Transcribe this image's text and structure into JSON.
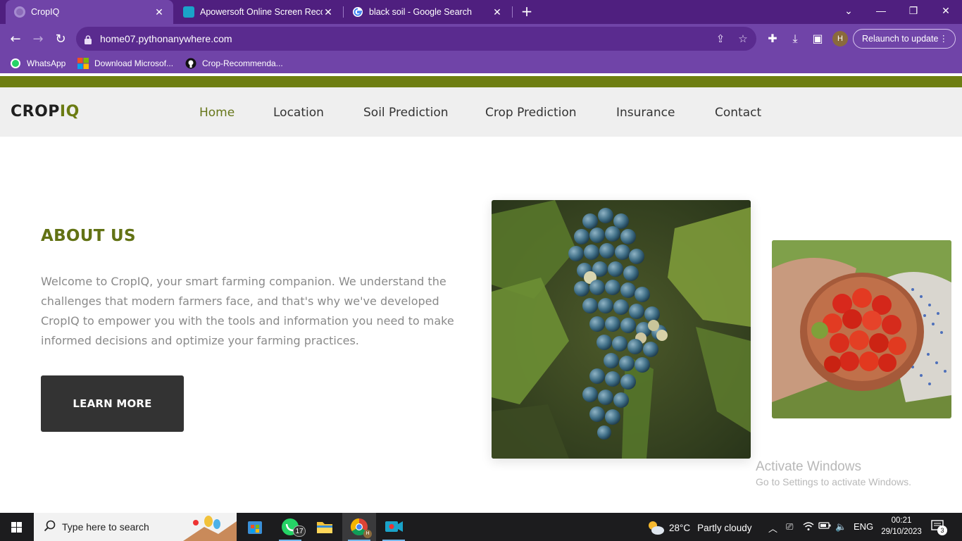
{
  "browser": {
    "tabs": [
      {
        "title": "CropIQ",
        "active": true
      },
      {
        "title": "Apowersoft Online Screen Recor",
        "active": false
      },
      {
        "title": "black soil - Google Search",
        "active": false
      }
    ],
    "url": "home07.pythonanywhere.com",
    "relaunch_label": "Relaunch to update",
    "profile_initial": "H",
    "bookmarks": [
      "WhatsApp",
      "Download Microsof...",
      "Crop-Recommenda..."
    ],
    "theme_color": "#7044a8"
  },
  "site": {
    "logo_part1": "CROP",
    "logo_part2": "IQ",
    "nav": [
      "Home",
      "Location",
      "Soil Prediction",
      "Crop Prediction",
      "Insurance",
      "Contact"
    ],
    "active_nav": "Home",
    "about": {
      "title": "ABOUT US",
      "text": "Welcome to CropIQ, your smart farming companion. We understand the challenges that modern farmers face, and that's why we've developed CropIQ to empower you with the tools and information you need to make informed decisions and optimize your farming practices.",
      "button": "LEARN MORE"
    },
    "accent_color": "#6a7b12"
  },
  "watermark": {
    "line1": "Activate Windows",
    "line2": "Go to Settings to activate Windows."
  },
  "taskbar": {
    "search_placeholder": "Type here to search",
    "whatsapp_badge": "17",
    "weather": {
      "temp": "28°C",
      "condition": "Partly cloudy"
    },
    "language": "ENG",
    "time": "00:21",
    "date": "29/10/2023",
    "notifications": "3"
  }
}
